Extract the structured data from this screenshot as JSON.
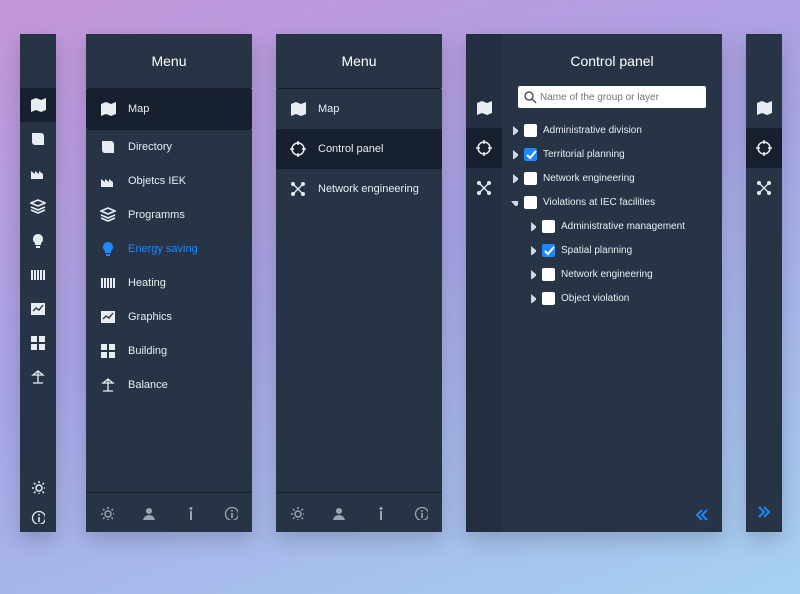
{
  "menu_title": "Menu",
  "control_title": "Control panel",
  "search_placeholder": "Name of the group or layer",
  "menu1": {
    "items": [
      {
        "key": "map",
        "label": "Map"
      },
      {
        "key": "directory",
        "label": "Directory"
      },
      {
        "key": "objects",
        "label": "Objetcs IEK"
      },
      {
        "key": "programms",
        "label": "Programms"
      },
      {
        "key": "energy",
        "label": "Energy saving"
      },
      {
        "key": "heating",
        "label": "Heating"
      },
      {
        "key": "graphics",
        "label": "Graphics"
      },
      {
        "key": "building",
        "label": "Building"
      },
      {
        "key": "balance",
        "label": "Balance"
      }
    ],
    "active": "map",
    "hover": "energy"
  },
  "menu2": {
    "items": [
      {
        "key": "map",
        "label": "Map"
      },
      {
        "key": "control",
        "label": "Control panel"
      },
      {
        "key": "network",
        "label": "Network engineering"
      }
    ],
    "active": "control"
  },
  "tree": {
    "nodes": [
      {
        "label": "Administrative division",
        "checked": false,
        "expanded": false
      },
      {
        "label": "Territorial planning",
        "checked": true,
        "expanded": false
      },
      {
        "label": "Network engineering",
        "checked": false,
        "expanded": false
      },
      {
        "label": "Violations at IEC facilities",
        "checked": false,
        "expanded": true,
        "children": [
          {
            "label": "Administrative management",
            "checked": false
          },
          {
            "label": "Spatial planning",
            "checked": true
          },
          {
            "label": "Network engineering",
            "checked": false
          },
          {
            "label": "Object violation",
            "checked": false
          }
        ]
      }
    ]
  }
}
